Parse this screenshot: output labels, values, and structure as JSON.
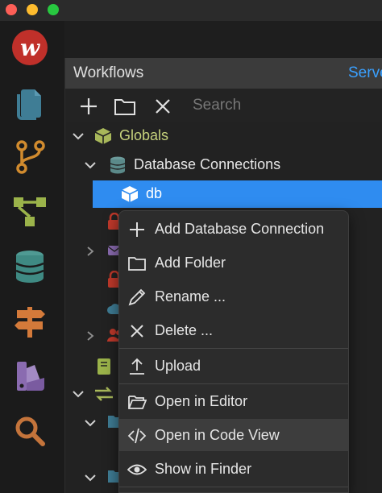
{
  "window": {
    "controls": [
      "close",
      "minimize",
      "maximize"
    ]
  },
  "activity_bar": {
    "items": [
      {
        "icon": "app-logo-icon"
      },
      {
        "icon": "documents-icon"
      },
      {
        "icon": "branches-icon"
      },
      {
        "icon": "hierarchy-icon"
      },
      {
        "icon": "database-icon"
      },
      {
        "icon": "signpost-icon"
      },
      {
        "icon": "palette-icon"
      },
      {
        "icon": "search-icon"
      }
    ]
  },
  "panel": {
    "title": "Workflows",
    "header_link": "Serve",
    "search_placeholder": "Search"
  },
  "tree": {
    "globals": "Globals",
    "database_connections": "Database Connections",
    "db": "db"
  },
  "context_menu": {
    "items": [
      {
        "label": "Add Database Connection",
        "icon": "plus-icon"
      },
      {
        "label": "Add Folder",
        "icon": "folder-icon"
      },
      {
        "label": "Rename ...",
        "icon": "pencil-icon"
      },
      {
        "label": "Delete ...",
        "icon": "close-icon"
      },
      {
        "label": "Upload",
        "icon": "upload-icon"
      },
      {
        "label": "Open in Editor",
        "icon": "folder-open-icon"
      },
      {
        "label": "Open in Code View",
        "icon": "code-icon"
      },
      {
        "label": "Show in Finder",
        "icon": "eye-icon"
      }
    ],
    "highlighted": "Open in Code View"
  },
  "colors": {
    "accent": "#2f8cf0",
    "link": "#3aa0ff",
    "globals_icon": "#a8b85a",
    "database_icon": "#6b9a9a",
    "lock_icon": "#c0392b"
  }
}
